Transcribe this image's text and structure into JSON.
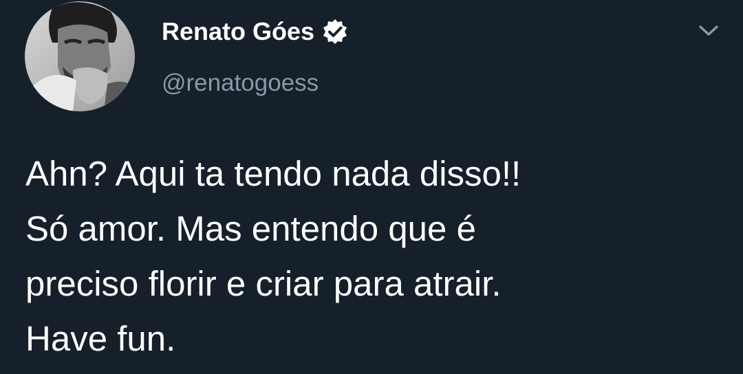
{
  "author": {
    "display_name": "Renato Góes",
    "handle": "@renatogoess",
    "verified": true,
    "avatar_icon": "profile-photo"
  },
  "tweet": {
    "lines": [
      "Ahn? Aqui ta tendo nada disso!!",
      "Só amor. Mas entendo que é",
      "preciso florir e criar para atrair.",
      "Have fun."
    ]
  },
  "icons": {
    "verified": "verified-badge-icon",
    "menu": "chevron-down-icon"
  },
  "colors": {
    "background": "#15202b",
    "text_primary": "#ffffff",
    "text_secondary": "#8899a6",
    "caret": "#8899a6"
  }
}
